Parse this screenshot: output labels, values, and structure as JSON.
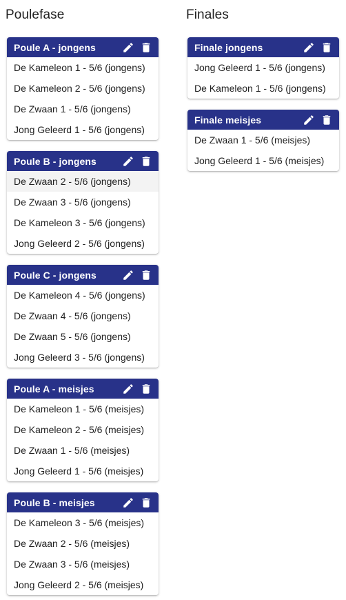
{
  "poulefase": {
    "title": "Poulefase",
    "cards": [
      {
        "title": "Poule A - jongens",
        "teams": [
          "De Kameleon 1 - 5/6 (jongens)",
          "De Kameleon 2 - 5/6 (jongens)",
          "De Zwaan 1 - 5/6 (jongens)",
          "Jong Geleerd 1 - 5/6 (jongens)"
        ]
      },
      {
        "title": "Poule B - jongens",
        "teams": [
          "De Zwaan 2 - 5/6 (jongens)",
          "De Zwaan 3 - 5/6 (jongens)",
          "De Kameleon 3 - 5/6 (jongens)",
          "Jong Geleerd 2 - 5/6 (jongens)"
        ]
      },
      {
        "title": "Poule C - jongens",
        "teams": [
          "De Kameleon 4 - 5/6 (jongens)",
          "De Zwaan 4 - 5/6 (jongens)",
          "De Zwaan 5 - 5/6 (jongens)",
          "Jong Geleerd 3 - 5/6 (jongens)"
        ]
      },
      {
        "title": "Poule A - meisjes",
        "teams": [
          "De Kameleon 1 - 5/6 (meisjes)",
          "De Kameleon 2 - 5/6 (meisjes)",
          "De Zwaan 1 - 5/6 (meisjes)",
          "Jong Geleerd 1 - 5/6 (meisjes)"
        ]
      },
      {
        "title": "Poule B - meisjes",
        "teams": [
          "De Kameleon 3 - 5/6 (meisjes)",
          "De Zwaan 2 - 5/6 (meisjes)",
          "De Zwaan 3 - 5/6 (meisjes)",
          "Jong Geleerd 2 - 5/6 (meisjes)"
        ]
      }
    ]
  },
  "finales": {
    "title": "Finales",
    "cards": [
      {
        "title": "Finale jongens",
        "teams": [
          "Jong Geleerd 1 - 5/6 (jongens)",
          "De Kameleon 1 - 5/6 (jongens)"
        ]
      },
      {
        "title": "Finale meisjes",
        "teams": [
          "De Zwaan 1 - 5/6 (meisjes)",
          "Jong Geleerd 1 - 5/6 (meisjes)"
        ]
      }
    ]
  },
  "icons": {
    "edit": "pencil-icon",
    "delete": "trash-icon"
  },
  "colors": {
    "header_bg": "#283289",
    "highlight_row": "#f3f3f3"
  }
}
